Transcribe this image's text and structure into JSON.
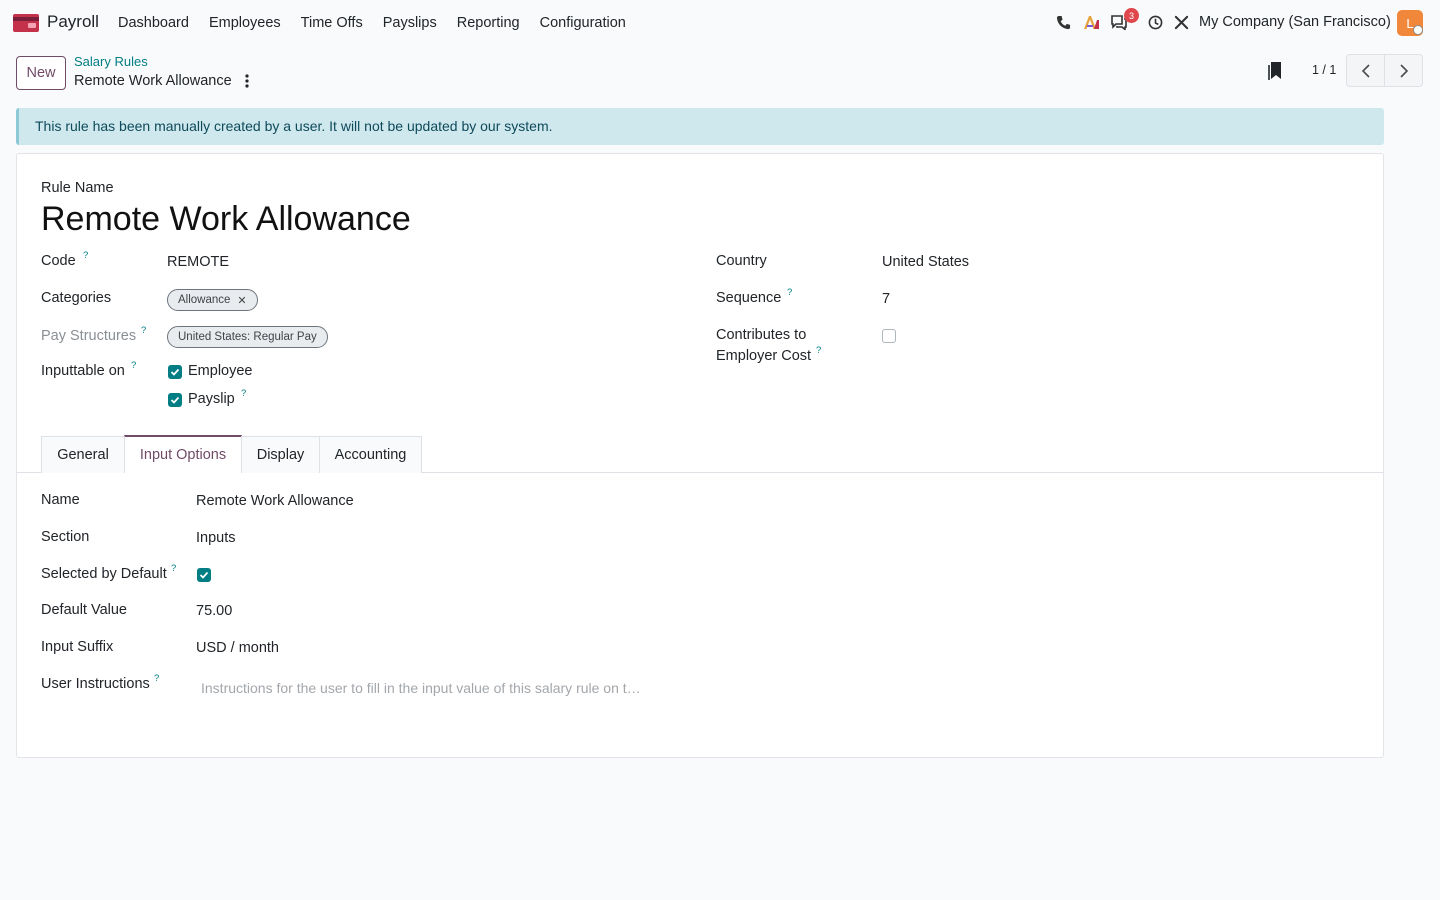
{
  "navbar": {
    "app_name": "Payroll",
    "menu": [
      "Dashboard",
      "Employees",
      "Time Offs",
      "Payslips",
      "Reporting",
      "Configuration"
    ],
    "chat_badge": "3",
    "company": "My Company (San Francisco)",
    "avatar_initial": "L"
  },
  "control_panel": {
    "new_label": "New",
    "breadcrumb_parent": "Salary Rules",
    "breadcrumb_current": "Remote Work Allowance",
    "pager_value": "1 / 1"
  },
  "alert": {
    "text": "This rule has been manually created by a user. It will not be updated by our system."
  },
  "form": {
    "rule_name_label": "Rule Name",
    "rule_name": "Remote Work Allowance",
    "code_label": "Code",
    "code_value": "REMOTE",
    "categories_label": "Categories",
    "category_tag": "Allowance",
    "pay_structures_label": "Pay Structures",
    "pay_structure_tag": "United States: Regular Pay",
    "inputtable_on_label": "Inputtable on",
    "employee_label": "Employee",
    "payslip_label": "Payslip",
    "country_label": "Country",
    "country_value": "United States",
    "sequence_label": "Sequence",
    "sequence_value": "7",
    "contributes_label_1": "Contributes to",
    "contributes_label_2": "Employer Cost",
    "help_mark": "?"
  },
  "tabs": [
    "General",
    "Input Options",
    "Display",
    "Accounting"
  ],
  "input_options": {
    "name_label": "Name",
    "name_value": "Remote Work Allowance",
    "section_label": "Section",
    "section_value": "Inputs",
    "selected_default_label": "Selected by Default",
    "default_value_label": "Default Value",
    "default_value": "75.00",
    "input_suffix_label": "Input Suffix",
    "input_suffix_value": "USD / month",
    "user_instructions_label": "User Instructions",
    "user_instructions_placeholder": "Instructions for the user to fill in the input value of this salary rule on t…"
  },
  "colors": {
    "brand": "#714b67",
    "accent": "#017e84",
    "alert_bg": "#cfe8ee"
  }
}
